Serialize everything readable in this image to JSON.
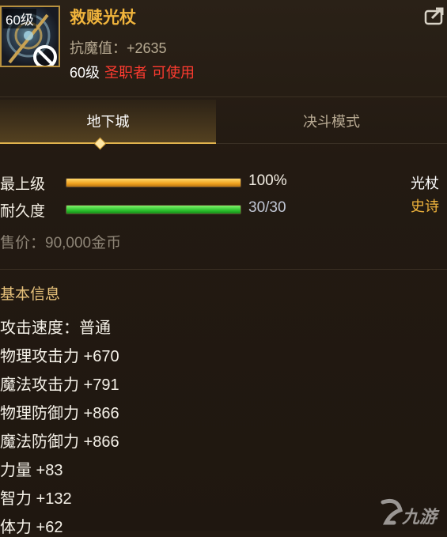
{
  "item": {
    "level_badge": "60级",
    "name": "救赎光杖",
    "anti_magic": "抗魔值：+2635",
    "req_level": "60级",
    "req_class": "圣职者",
    "req_usable": "可使用"
  },
  "tabs": [
    {
      "label": "地下城",
      "active": true
    },
    {
      "label": "决斗模式",
      "active": false
    }
  ],
  "grade": {
    "label": "最上级",
    "value": "100%",
    "fill": 1.0
  },
  "durability": {
    "label": "耐久度",
    "value": "30/30",
    "fill": 1.0
  },
  "type": "光杖",
  "rarity": "史诗",
  "sell_price": "售价：90,000金币",
  "basic_info": {
    "title": "基本信息",
    "stats": [
      "攻击速度：普通",
      "物理攻击力 +670",
      "魔法攻击力 +791",
      "物理防御力 +866",
      "魔法防御力 +866",
      "力量 +83",
      "智力 +132",
      "体力 +62"
    ]
  },
  "watermark": "九游",
  "colors": {
    "item_name": "#f0b43c",
    "warning_red": "#ff3b30",
    "grade_bar": "#f0a21f",
    "durability_bar": "#2cc12d",
    "rarity_epic": "#f0b43c"
  },
  "icons": [
    "staff-item-icon",
    "ban-icon",
    "export-icon",
    "watermark-logo-icon"
  ]
}
